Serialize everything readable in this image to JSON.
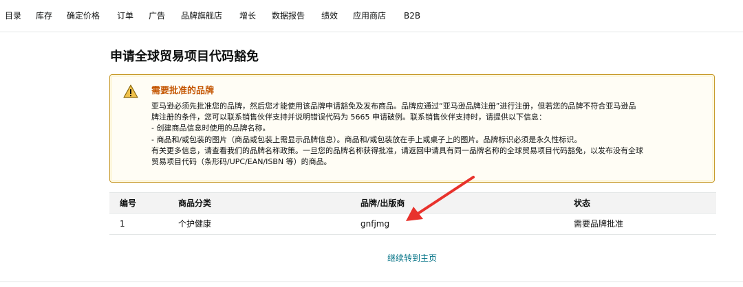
{
  "nav": {
    "items": [
      {
        "label": "目录"
      },
      {
        "label": "库存"
      },
      {
        "label": "确定价格"
      },
      {
        "label": "订单"
      },
      {
        "label": "广告"
      },
      {
        "label": "品牌旗舰店"
      },
      {
        "label": "增长"
      },
      {
        "label": "数据报告"
      },
      {
        "label": "绩效"
      },
      {
        "label": "应用商店"
      },
      {
        "label": "B2B"
      }
    ]
  },
  "page": {
    "title": "申请全球贸易项目代码豁免"
  },
  "alert": {
    "icon": "warning-icon",
    "heading": "需要批准的品牌",
    "lines": [
      "亚马逊必须先批准您的品牌，然后您才能使用该品牌申请豁免及发布商品。品牌应通过“亚马逊品牌注册”进行注册，但若您的品牌不符合亚马逊品",
      "牌注册的条件，您可以联系销售伙伴支持并说明错误代码为 5665 申请破例。联系销售伙伴支持时，请提供以下信息：",
      "- 创建商品信息时使用的品牌名称。",
      "- 商品和/或包装的图片（商品或包装上需显示品牌信息）。商品和/或包装放在手上或桌子上的图片。品牌标识必须是永久性标识。",
      "有关更多信息，请查看我们的品牌名称政策。一旦您的品牌名称获得批准，请返回申请具有同一品牌名称的全球贸易项目代码豁免，以发布没有全球",
      "贸易项目代码（条形码/UPC/EAN/ISBN 等）的商品。"
    ],
    "colors": {
      "heading": "#c45500",
      "border": "#c79a2a",
      "icon": "#f0c14b"
    }
  },
  "table": {
    "headers": [
      "编号",
      "商品分类",
      "品牌/出版商",
      "状态"
    ],
    "rows": [
      [
        "1",
        "个护健康",
        "gnfjmg",
        "需要品牌批准"
      ]
    ]
  },
  "footer": {
    "continue_link": "继续转到主页",
    "link_color": "#007185"
  },
  "annotation": {
    "arrow_color": "#e8322c"
  }
}
